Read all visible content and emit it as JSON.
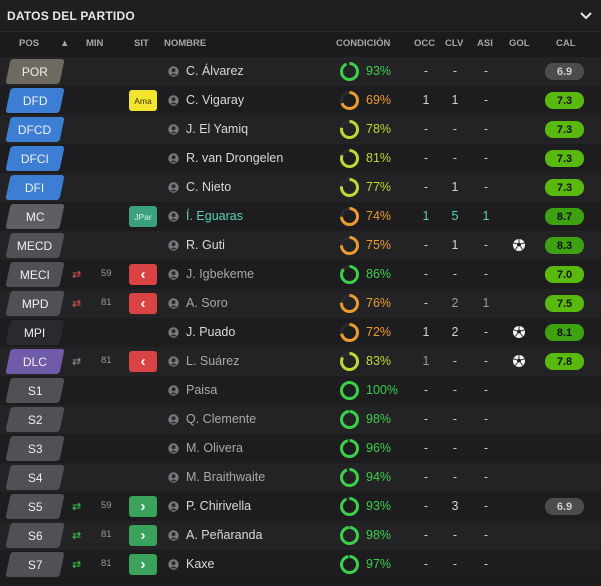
{
  "title": "DATOS DEL PARTIDO",
  "columns": {
    "pos": "POS",
    "min": "MIN",
    "sit": "SIT",
    "nombre": "NOMBRE",
    "condicion": "CONDICIÓN",
    "occ": "OCC",
    "clv": "CLV",
    "asi": "ASI",
    "gol": "GOL",
    "cal": "CAL"
  },
  "colors": {
    "green": "#3ccf4a",
    "orange": "#ec9b2f",
    "yellow_green": "#c3d634",
    "rating_green": "#5ab90f",
    "rating_dark_green": "#3da112",
    "rating_grey": "#4c4c4f",
    "sub_out_red": "#d94343",
    "sub_in_green": "#3aa25a",
    "teal": "#5ad1b3"
  },
  "players": [
    {
      "pos": "POR",
      "pos_color": "#6f6a60",
      "min_icon": "",
      "min": "",
      "sit": "",
      "sit_type": "",
      "name": "C. Álvarez",
      "name_color": "#d9d9d9",
      "cond": "93%",
      "cond_value": 93,
      "cond_color": "#3ccf4a",
      "occ": "-",
      "clv": "-",
      "asi": "-",
      "gol": "",
      "cal": "6.9",
      "cal_style": "grey"
    },
    {
      "pos": "DFD",
      "pos_color": "#3c7ed3",
      "min_icon": "",
      "min": "",
      "sit": "Ama",
      "sit_type": "yellow",
      "name": "C. Vigaray",
      "name_color": "#d9d9d9",
      "cond": "69%",
      "cond_value": 69,
      "cond_color": "#ec9b2f",
      "occ": "1",
      "clv": "1",
      "asi": "-",
      "gol": "",
      "cal": "7.3",
      "cal_style": "green"
    },
    {
      "pos": "DFCD",
      "pos_color": "#3c7ed3",
      "min_icon": "",
      "min": "",
      "sit": "",
      "sit_type": "",
      "name": "J. El Yamiq",
      "name_color": "#d9d9d9",
      "cond": "78%",
      "cond_value": 78,
      "cond_color": "#c3d634",
      "occ": "-",
      "clv": "-",
      "asi": "-",
      "gol": "",
      "cal": "7.3",
      "cal_style": "green"
    },
    {
      "pos": "DFCI",
      "pos_color": "#3c7ed3",
      "min_icon": "",
      "min": "",
      "sit": "",
      "sit_type": "",
      "name": "R. van Drongelen",
      "name_color": "#d9d9d9",
      "cond": "81%",
      "cond_value": 81,
      "cond_color": "#c3d634",
      "occ": "-",
      "clv": "-",
      "asi": "-",
      "gol": "",
      "cal": "7.3",
      "cal_style": "green"
    },
    {
      "pos": "DFI",
      "pos_color": "#3c7ed3",
      "min_icon": "",
      "min": "",
      "sit": "",
      "sit_type": "",
      "name": "C. Nieto",
      "name_color": "#d9d9d9",
      "cond": "77%",
      "cond_value": 77,
      "cond_color": "#c3d634",
      "occ": "-",
      "clv": "1",
      "asi": "-",
      "gol": "",
      "cal": "7.3",
      "cal_style": "green"
    },
    {
      "pos": "MC",
      "pos_color": "#5f5f63",
      "min_icon": "",
      "min": "",
      "sit": "JPar",
      "sit_type": "teal",
      "name": "Í. Eguaras",
      "name_color": "#5ad1b3",
      "cond": "74%",
      "cond_value": 74,
      "cond_color": "#ec9b2f",
      "occ": "1",
      "clv": "5",
      "asi": "1",
      "gol": "",
      "cal": "8.7",
      "cal_style": "darkgreen",
      "stats_color": "#5ad1b3"
    },
    {
      "pos": "MECD",
      "pos_color": "#505055",
      "min_icon": "",
      "min": "",
      "sit": "",
      "sit_type": "",
      "name": "R. Guti",
      "name_color": "#d9d9d9",
      "cond": "75%",
      "cond_value": 75,
      "cond_color": "#ec9b2f",
      "occ": "-",
      "clv": "1",
      "asi": "-",
      "gol": "ball",
      "cal": "8.3",
      "cal_style": "darkgreen"
    },
    {
      "pos": "MECI",
      "pos_color": "#505055",
      "min_icon": "out",
      "min": "59",
      "sit": "‹",
      "sit_type": "out",
      "name": "J. Igbekeme",
      "name_color": "#a8a8a8",
      "cond": "86%",
      "cond_value": 86,
      "cond_color": "#3ccf4a",
      "occ": "-",
      "clv": "-",
      "asi": "-",
      "gol": "",
      "cal": "7.0",
      "cal_style": "green"
    },
    {
      "pos": "MPD",
      "pos_color": "#505055",
      "min_icon": "out",
      "min": "81",
      "sit": "‹",
      "sit_type": "out",
      "name": "A. Soro",
      "name_color": "#a8a8a8",
      "cond": "76%",
      "cond_value": 76,
      "cond_color": "#ec9b2f",
      "occ": "-",
      "clv": "2",
      "asi": "1",
      "gol": "",
      "cal": "7.5",
      "cal_style": "green"
    },
    {
      "pos": "MPI",
      "pos_color": "#2a2a2e",
      "min_icon": "",
      "min": "",
      "sit": "",
      "sit_type": "",
      "name": "J. Puado",
      "name_color": "#d9d9d9",
      "cond": "72%",
      "cond_value": 72,
      "cond_color": "#ec9b2f",
      "occ": "1",
      "clv": "2",
      "asi": "-",
      "gol": "ball",
      "cal": "8.1",
      "cal_style": "darkgreen"
    },
    {
      "pos": "DLC",
      "pos_color": "#6f5ba8",
      "min_icon": "out-grey",
      "min": "81",
      "sit": "‹",
      "sit_type": "out",
      "name": "L. Suárez",
      "name_color": "#a8a8a8",
      "cond": "83%",
      "cond_value": 83,
      "cond_color": "#c3d634",
      "occ": "1",
      "clv": "-",
      "asi": "-",
      "gol": "ball",
      "cal": "7.8",
      "cal_style": "green"
    },
    {
      "pos": "S1",
      "pos_color": "#505055",
      "min_icon": "",
      "min": "",
      "sit": "",
      "sit_type": "",
      "name": "Paisa",
      "name_color": "#a8a8a8",
      "cond": "100%",
      "cond_value": 100,
      "cond_color": "#3ccf4a",
      "occ": "-",
      "clv": "-",
      "asi": "-",
      "gol": "",
      "cal": "",
      "cal_style": ""
    },
    {
      "pos": "S2",
      "pos_color": "#505055",
      "min_icon": "",
      "min": "",
      "sit": "",
      "sit_type": "",
      "name": "Q. Clemente",
      "name_color": "#a8a8a8",
      "cond": "98%",
      "cond_value": 98,
      "cond_color": "#3ccf4a",
      "occ": "-",
      "clv": "-",
      "asi": "-",
      "gol": "",
      "cal": "",
      "cal_style": ""
    },
    {
      "pos": "S3",
      "pos_color": "#505055",
      "min_icon": "",
      "min": "",
      "sit": "",
      "sit_type": "",
      "name": "M. Olivera",
      "name_color": "#a8a8a8",
      "cond": "96%",
      "cond_value": 96,
      "cond_color": "#3ccf4a",
      "occ": "-",
      "clv": "-",
      "asi": "-",
      "gol": "",
      "cal": "",
      "cal_style": ""
    },
    {
      "pos": "S4",
      "pos_color": "#505055",
      "min_icon": "",
      "min": "",
      "sit": "",
      "sit_type": "",
      "name": "M. Braithwaite",
      "name_color": "#a8a8a8",
      "cond": "94%",
      "cond_value": 94,
      "cond_color": "#3ccf4a",
      "occ": "-",
      "clv": "-",
      "asi": "-",
      "gol": "",
      "cal": "",
      "cal_style": ""
    },
    {
      "pos": "S5",
      "pos_color": "#505055",
      "min_icon": "in",
      "min": "59",
      "sit": "›",
      "sit_type": "in",
      "name": "P. Chirivella",
      "name_color": "#d9d9d9",
      "cond": "93%",
      "cond_value": 93,
      "cond_color": "#3ccf4a",
      "occ": "-",
      "clv": "3",
      "asi": "-",
      "gol": "",
      "cal": "6.9",
      "cal_style": "grey"
    },
    {
      "pos": "S6",
      "pos_color": "#505055",
      "min_icon": "in",
      "min": "81",
      "sit": "›",
      "sit_type": "in",
      "name": "A. Peñaranda",
      "name_color": "#d9d9d9",
      "cond": "98%",
      "cond_value": 98,
      "cond_color": "#3ccf4a",
      "occ": "-",
      "clv": "-",
      "asi": "-",
      "gol": "",
      "cal": "",
      "cal_style": ""
    },
    {
      "pos": "S7",
      "pos_color": "#505055",
      "min_icon": "in",
      "min": "81",
      "sit": "›",
      "sit_type": "in",
      "name": "Kaxe",
      "name_color": "#d9d9d9",
      "cond": "97%",
      "cond_value": 97,
      "cond_color": "#3ccf4a",
      "occ": "-",
      "clv": "-",
      "asi": "-",
      "gol": "",
      "cal": "",
      "cal_style": ""
    }
  ]
}
